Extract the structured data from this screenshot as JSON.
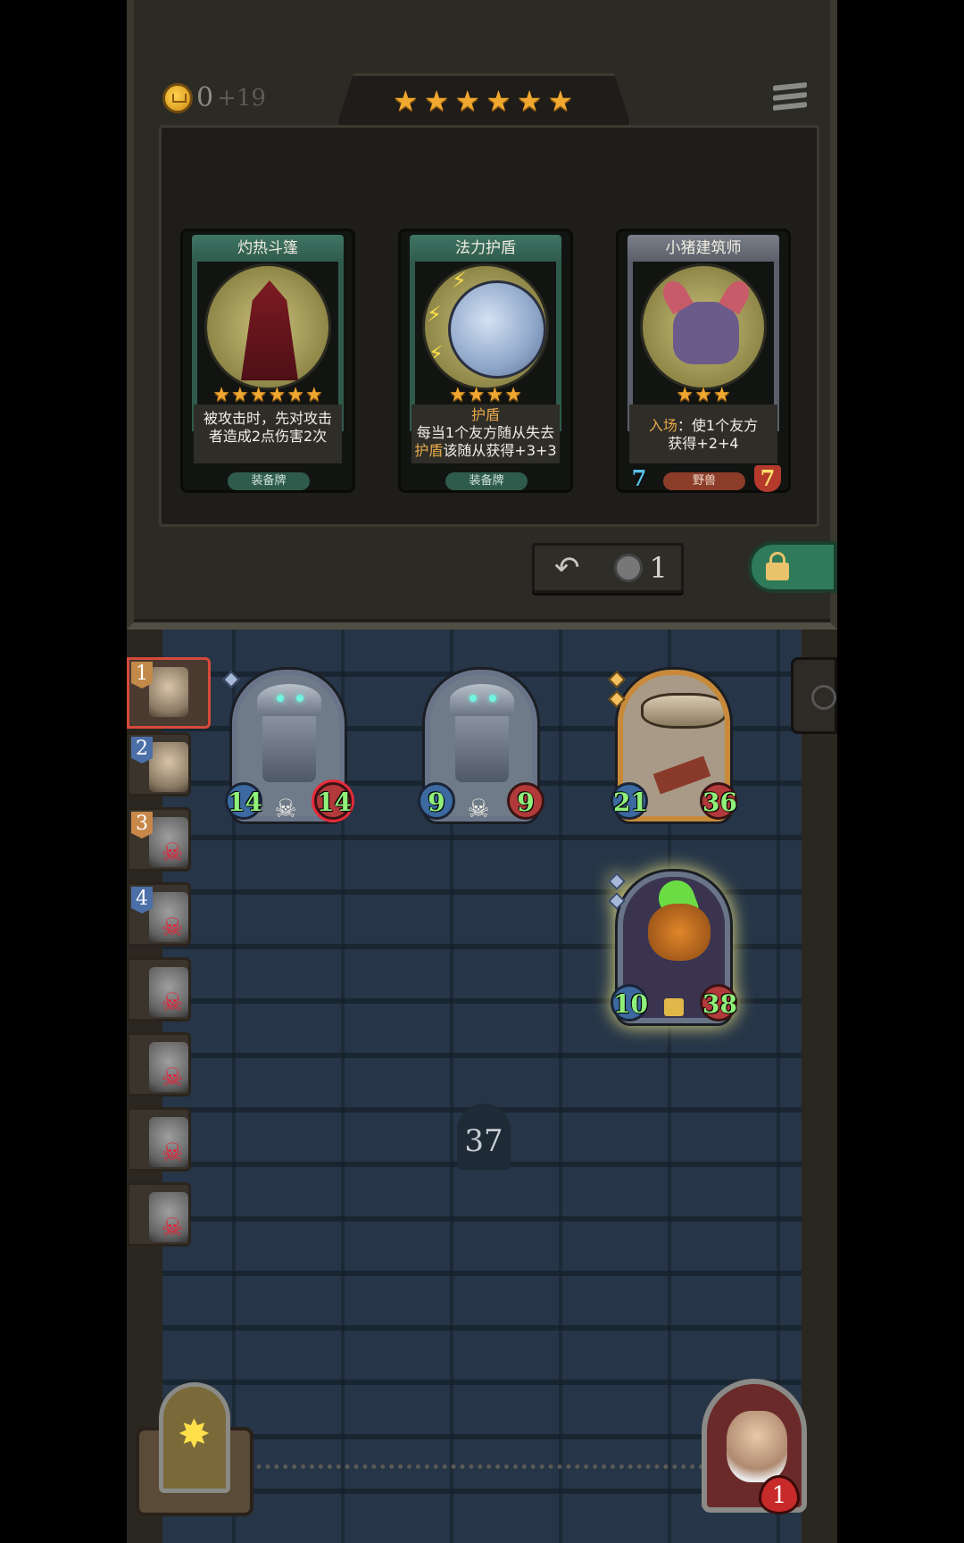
{
  "shop": {
    "gold": "0",
    "gold_income": "+19",
    "tavern_tier_stars": 6,
    "cards": [
      {
        "name": "灼热斗篷",
        "stars": 6,
        "desc_lines": [
          "被攻击时，先对攻击",
          "者造成2点伤害2次"
        ],
        "type": "装备牌",
        "kind": "equipment"
      },
      {
        "name": "法力护盾",
        "stars": 4,
        "desc_lines": [
          "护盾",
          "每当1个友方随从失去",
          "护盾该随从获得+3+3"
        ],
        "type": "装备牌",
        "kind": "equipment"
      },
      {
        "name": "小猪建筑师",
        "stars": 3,
        "desc_lines": [
          "入场：使1个友方",
          "获得+2+4"
        ],
        "type": "野兽",
        "kind": "beast",
        "attack": "7",
        "health": "7"
      }
    ],
    "reroll_cost": "1"
  },
  "leaderboard": [
    {
      "rank": "1",
      "dead": false,
      "me": true
    },
    {
      "rank": "2",
      "dead": false
    },
    {
      "rank": "3",
      "dead": true
    },
    {
      "rank": "4",
      "dead": true
    },
    {
      "rank": "",
      "dead": true
    },
    {
      "rank": "",
      "dead": true
    },
    {
      "rank": "",
      "dead": true
    },
    {
      "rank": "",
      "dead": true
    }
  ],
  "board": {
    "minions": [
      {
        "attack": "14",
        "health": "14",
        "type": "robot"
      },
      {
        "attack": "9",
        "health": "9",
        "type": "robot"
      },
      {
        "attack": "21",
        "health": "36",
        "type": "zeppelin"
      },
      {
        "attack": "10",
        "health": "38",
        "type": "pumpkin"
      }
    ],
    "turn": "37"
  },
  "hero": {
    "health": "1"
  },
  "colors": {
    "star": "#f0a830",
    "stat_green": "#8ff07a",
    "selected_border": "#d64a3a"
  }
}
